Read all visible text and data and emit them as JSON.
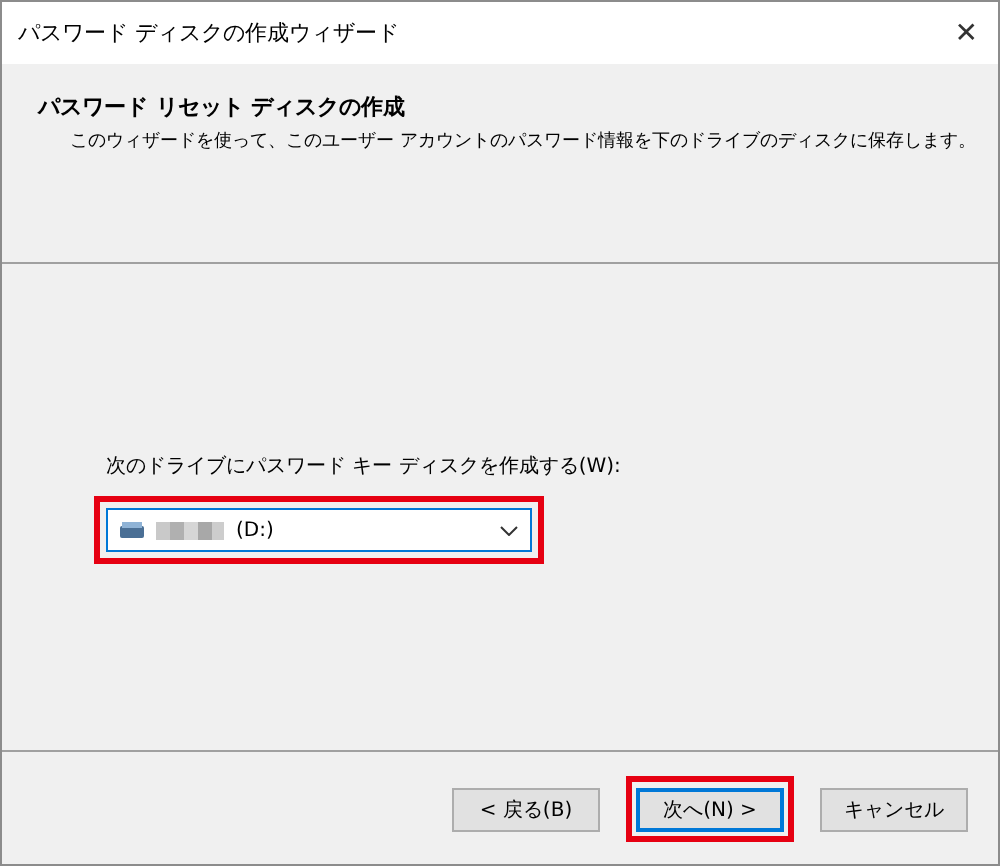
{
  "window": {
    "title": "パスワード ディスクの作成ウィザード",
    "close": "✕"
  },
  "header": {
    "title": "パスワード リセット ディスクの作成",
    "description": "このウィザードを使って、このユーザー アカウントのパスワード情報を下のドライブのディスクに保存します。"
  },
  "drive": {
    "label": "次のドライブにパスワード キー ディスクを作成する(W):",
    "value": "(D:)",
    "highlighted": true
  },
  "buttons": [
    {
      "label": "< 戻る(B)",
      "focused": false,
      "highlighted": false
    },
    {
      "label": "次へ(N) >",
      "focused": true,
      "highlighted": true
    },
    {
      "label": "キャンセル",
      "focused": false,
      "highlighted": false
    }
  ]
}
